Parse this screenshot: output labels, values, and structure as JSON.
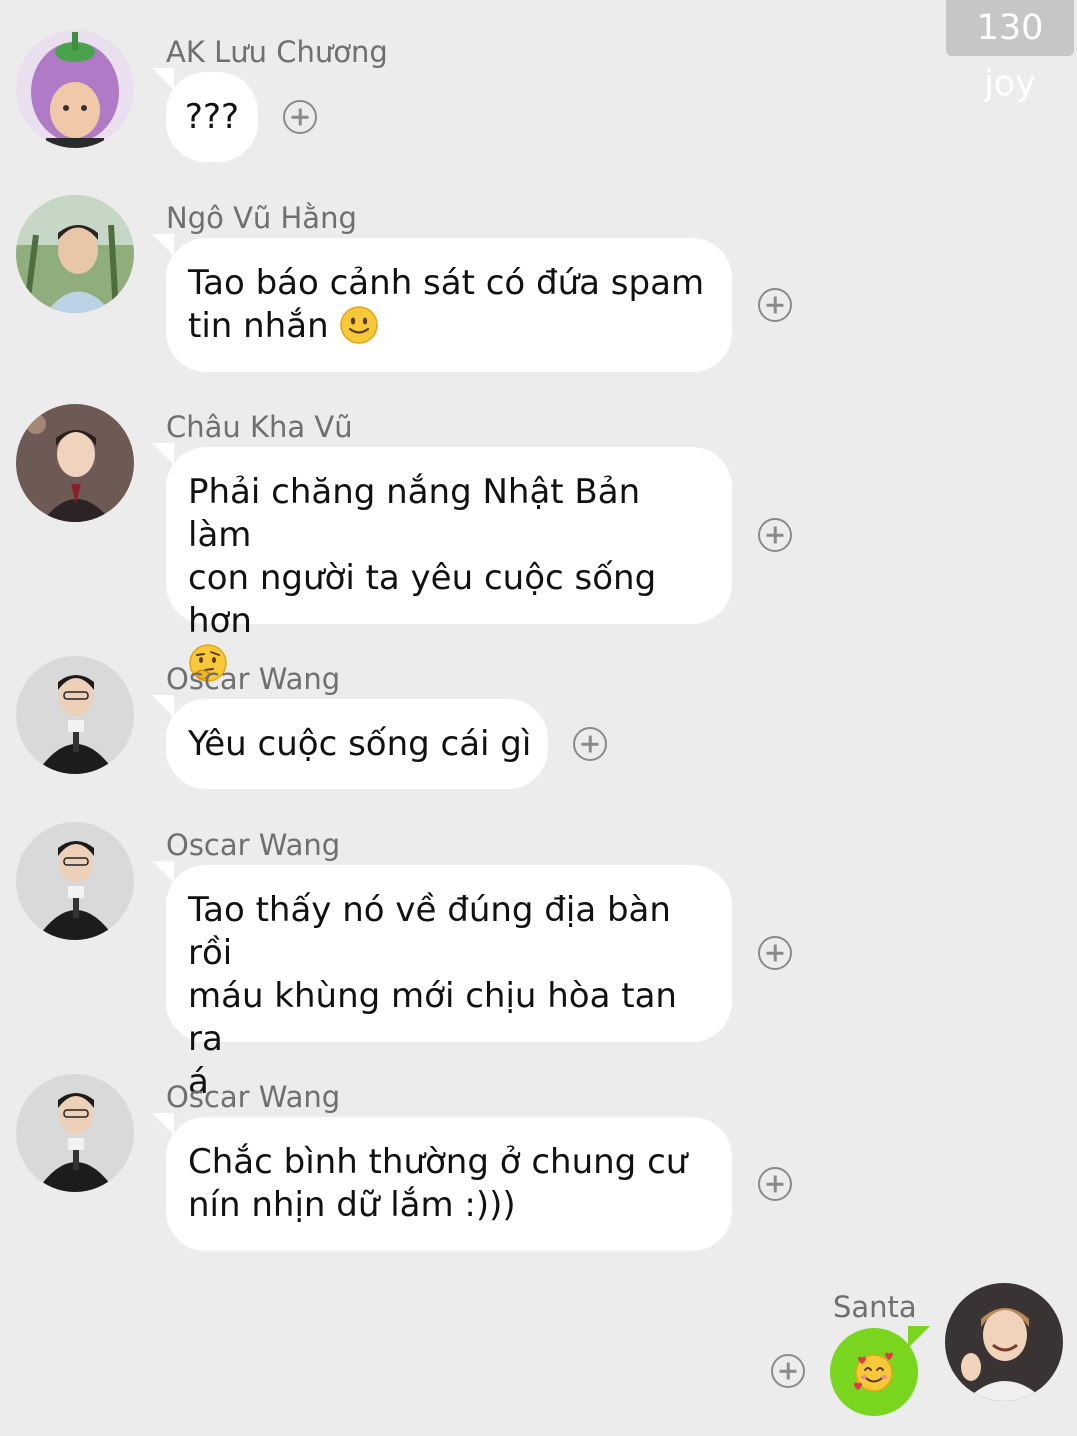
{
  "watermark": "130 joy",
  "messages": [
    {
      "sender": "AK Lưu Chương",
      "avatar": "eggplant-hat-avatar",
      "lines": [
        "???"
      ]
    },
    {
      "sender": "Ngô Vũ Hằng",
      "avatar": "outdoor-portrait-avatar",
      "lines": [
        "Tao báo cảnh sát có đứa spam",
        "tin nhắn"
      ],
      "emoji": "slightly-smiling-face"
    },
    {
      "sender": "Châu Kha Vũ",
      "avatar": "stage-portrait-avatar",
      "lines": [
        "Phải chăng nắng Nhật Bản làm",
        "con người ta yêu cuộc sống hơn"
      ],
      "emoji": "thinking-face"
    },
    {
      "sender": "Oscar Wang",
      "avatar": "microphone-portrait-avatar",
      "lines": [
        "Yêu cuộc sống cái gì"
      ]
    },
    {
      "sender": "Oscar Wang",
      "avatar": "microphone-portrait-avatar",
      "lines": [
        "Tao thấy nó về đúng địa bàn rồi",
        "máu khùng mới chịu hòa tan ra",
        "á"
      ]
    },
    {
      "sender": "Oscar Wang",
      "avatar": "microphone-portrait-avatar",
      "lines": [
        "Chắc bình thường ở chung cư",
        "nín nhịn dữ lắm :)))"
      ]
    }
  ],
  "own_message": {
    "sender": "Santa",
    "avatar": "smiling-portrait-avatar",
    "emoji": "smiling-face-with-hearts"
  },
  "colors": {
    "background": "#ececec",
    "bubble": "#ffffff",
    "own_bubble": "#79d51e",
    "name_text": "#6f6f6f"
  }
}
